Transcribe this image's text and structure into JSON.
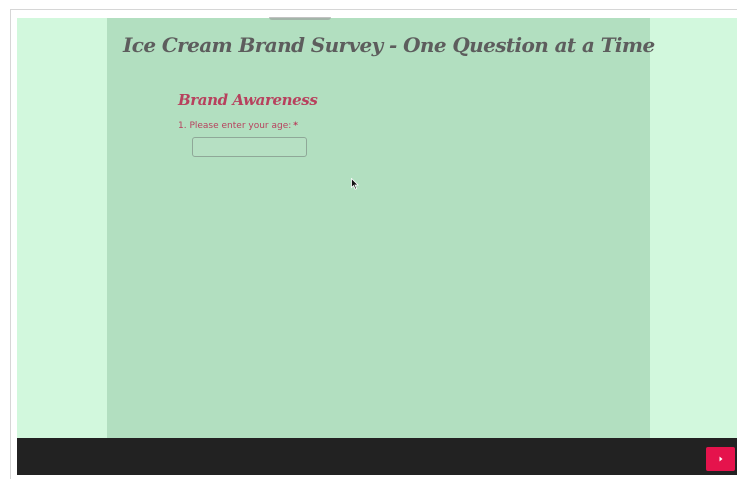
{
  "survey": {
    "title": "Ice Cream Brand Survey - One Question at a Time"
  },
  "section": {
    "title": "Brand Awareness"
  },
  "question": {
    "label": "1. Please enter your age:",
    "required_marker": "*",
    "answer_value": "",
    "answer_placeholder": ""
  },
  "footer": {
    "next_icon": "caret-right-icon"
  },
  "colors": {
    "outer_background": "#d2f8dd",
    "panel_background": "#b2dfc0",
    "title_text": "#5d5d5d",
    "accent_text": "#b7415d",
    "footer_bar": "#222222",
    "next_button": "#e5134c"
  }
}
